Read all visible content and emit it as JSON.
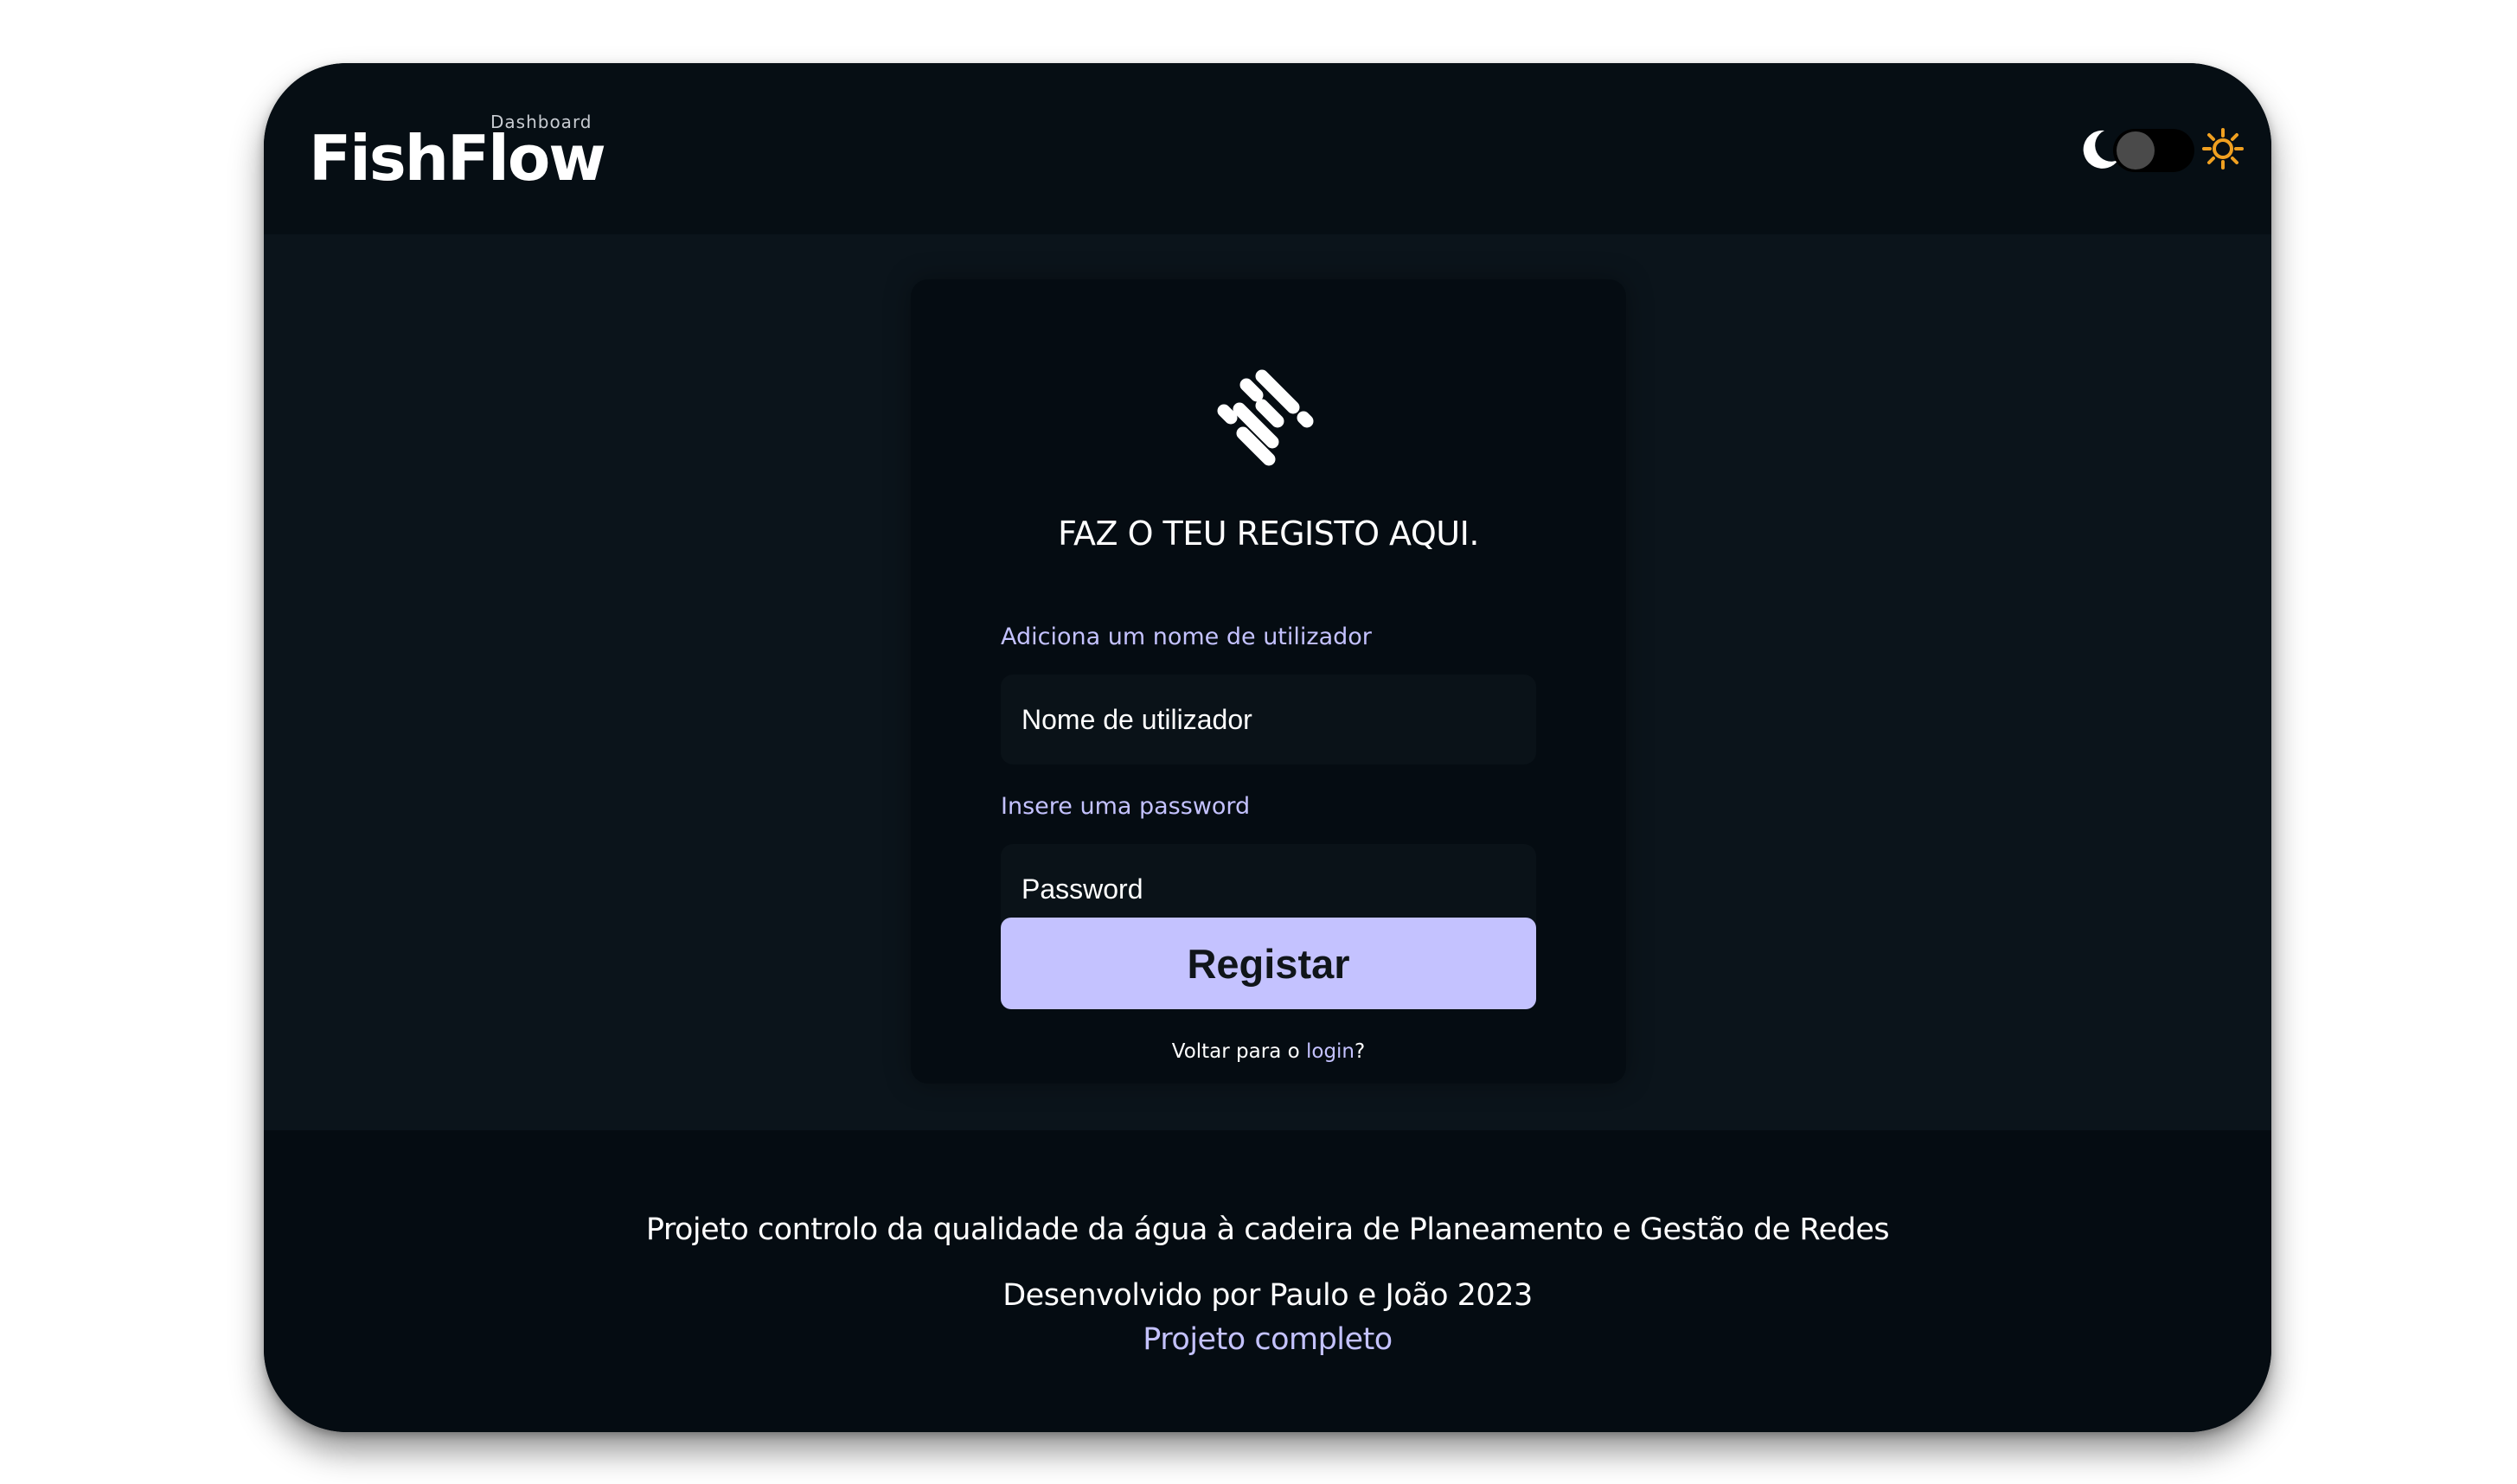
{
  "header": {
    "logo_text": "FishFlow",
    "logo_subtitle": "Dashboard",
    "theme_toggle": {
      "dark_icon": "moon-icon",
      "light_icon": "sun-icon",
      "state": "dark"
    }
  },
  "form": {
    "icon": "app-logo-icon",
    "title": "FAZ O TEU REGISTO AQUI.",
    "username_label": "Adiciona um nome de utilizador",
    "username_placeholder": "Nome de utilizador",
    "username_value": "",
    "password_label": "Insere uma password",
    "password_placeholder": "Password",
    "password_value": "",
    "submit_label": "Registar",
    "back_text": "Voltar para o",
    "back_link": "login",
    "back_suffix": "?"
  },
  "footer": {
    "line1": "Projeto controlo da qualidade da água à cadeira de Planeamento e Gestão de Redes",
    "line2": "Desenvolvido por Paulo e João 2023",
    "link": "Projeto completo"
  },
  "colors": {
    "accent": "#c4c2ff",
    "background": "#0b141b",
    "surface": "#050c12",
    "sun": "#f0a020"
  }
}
